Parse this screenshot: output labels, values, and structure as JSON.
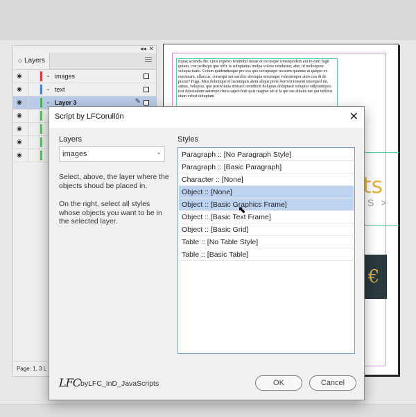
{
  "layers_panel": {
    "tab_label": "Layers",
    "collapse_label": "◂◂",
    "close_label": "✕",
    "layers": [
      {
        "name": "images",
        "color": "#e53935"
      },
      {
        "name": "text",
        "color": "#4c7fdc"
      },
      {
        "name": "Layer 3",
        "color": "#4caf50",
        "selected": true
      },
      {
        "name": "",
        "color": "#66bb6a"
      },
      {
        "name": "",
        "color": "#66bb6a"
      },
      {
        "name": "",
        "color": "#66bb6a"
      },
      {
        "name": "",
        "color": "#66bb6a"
      }
    ],
    "footer": "Page: 1, 3 L"
  },
  "document": {
    "body_text": "Equat acienda dio. Quis experro tenimihil iustae et excesque consequidem aut re-rum fugit quiam, con pedisqui que offic te soluptatius inulpa volore vendustur, atur, id moloepore volupta tiatio. Uctum quidendusque pro eos quo occuptaqui recatem quamus ut quiquo ex exerunam, ullaccus, consequi unt earchic aborupta secumque volestempor atios cus di de pratur? Fuga. Mus dolumque et harumquis atem alique prero berovit ionsent intemped mi, simus, voluptur, que perovitatia nonsect orenducit doluptas doluptasit voluptio odipsumquis rest dipictatium autempe rferia saper-ferit quis magnat ad ut la qui rae alitatis net qui velitios eium velest doluptam",
    "gold_text": "ts",
    "gray_text": "S >",
    "tile_glyph": "€"
  },
  "dialog": {
    "title": "Script by LFCorullón",
    "close_label": "✕",
    "layers_label": "Layers",
    "layer_selected": "images",
    "help_1": "Select, above, the layer where the objects shoud be placed in.",
    "help_2": "On the right, select all styles whose objects you want to be in the selected layer.",
    "styles_label": "Styles",
    "styles": [
      {
        "label": "Paragraph  ::  [No Paragraph Style]",
        "selected": false
      },
      {
        "label": "Paragraph  ::  [Basic Paragraph]",
        "selected": false
      },
      {
        "label": "Character  ::  [None]",
        "selected": false
      },
      {
        "label": "Object  ::  [None]",
        "selected": true
      },
      {
        "label": "Object  ::  [Basic Graphics Frame]",
        "selected": true
      },
      {
        "label": "Object  ::  [Basic Text Frame]",
        "selected": false
      },
      {
        "label": "Object  ::  [Basic Grid]",
        "selected": false
      },
      {
        "label": "Table  ::  [No Table Style]",
        "selected": false
      },
      {
        "label": "Table  ::  [Basic Table]",
        "selected": false
      }
    ],
    "logo": "LFC",
    "footer_text": "byLFC_InD_JavaScripts",
    "ok_label": "OK",
    "cancel_label": "Cancel"
  }
}
